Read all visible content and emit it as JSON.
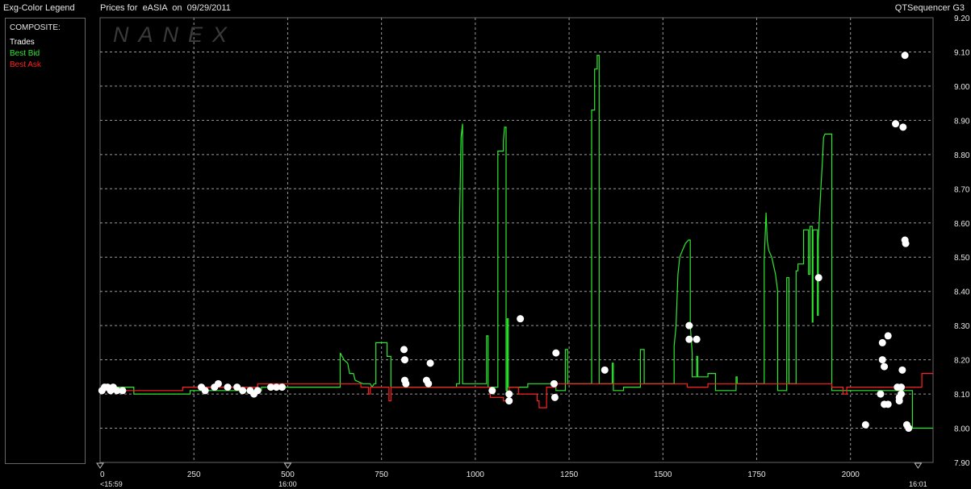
{
  "header": {
    "legend_title": "Exg-Color Legend",
    "chart_title": "Prices for  eASIA  on  09/29/2011",
    "app_name": "QTSequencer G3"
  },
  "legend": {
    "group_label": "COMPOSITE:",
    "items": [
      {
        "label": "Trades",
        "color": "#ffffff"
      },
      {
        "label": "Best Bid",
        "color": "#2ee82e"
      },
      {
        "label": "Best Ask",
        "color": "#ff2020"
      }
    ]
  },
  "watermark": "NANEX",
  "chart_data": {
    "type": "line",
    "title": "Prices for  eASIA  on  09/29/2011",
    "xlim": [
      0,
      2220
    ],
    "ylim": [
      7.9,
      9.2
    ],
    "x_ticks": [
      0,
      250,
      500,
      750,
      1000,
      1250,
      1500,
      1750,
      2000
    ],
    "y_ticks": [
      "9.20",
      "9.10",
      "9.00",
      "8.90",
      "8.80",
      "8.70",
      "8.60",
      "8.50",
      "8.40",
      "8.30",
      "8.20",
      "8.10",
      "8.00",
      "7.90"
    ],
    "time_labels": [
      {
        "x": 0,
        "label": "<15:59"
      },
      {
        "x": 500,
        "label": "16:00"
      },
      {
        "x": 2180,
        "label": "16:01"
      }
    ],
    "grid": true,
    "series": [
      {
        "name": "Best Bid",
        "color": "#2ee82e",
        "points": [
          [
            0,
            8.11
          ],
          [
            20,
            8.12
          ],
          [
            90,
            8.12
          ],
          [
            90,
            8.1
          ],
          [
            240,
            8.1
          ],
          [
            240,
            8.11
          ],
          [
            430,
            8.11
          ],
          [
            430,
            8.12
          ],
          [
            640,
            8.12
          ],
          [
            640,
            8.22
          ],
          [
            650,
            8.2
          ],
          [
            660,
            8.19
          ],
          [
            665,
            8.16
          ],
          [
            675,
            8.16
          ],
          [
            680,
            8.14
          ],
          [
            700,
            8.13
          ],
          [
            720,
            8.13
          ],
          [
            725,
            8.12
          ],
          [
            730,
            8.13
          ],
          [
            735,
            8.13
          ],
          [
            735,
            8.25
          ],
          [
            765,
            8.25
          ],
          [
            765,
            8.21
          ],
          [
            775,
            8.21
          ],
          [
            775,
            8.12
          ],
          [
            950,
            8.12
          ],
          [
            950,
            8.13
          ],
          [
            958,
            8.13
          ],
          [
            958,
            8.6
          ],
          [
            962,
            8.85
          ],
          [
            966,
            8.89
          ],
          [
            966,
            8.13
          ],
          [
            1030,
            8.13
          ],
          [
            1030,
            8.27
          ],
          [
            1034,
            8.27
          ],
          [
            1034,
            8.12
          ],
          [
            1060,
            8.12
          ],
          [
            1060,
            8.81
          ],
          [
            1075,
            8.81
          ],
          [
            1075,
            8.84
          ],
          [
            1078,
            8.88
          ],
          [
            1082,
            8.88
          ],
          [
            1082,
            8.11
          ],
          [
            1085,
            8.11
          ],
          [
            1085,
            8.32
          ],
          [
            1088,
            8.32
          ],
          [
            1088,
            8.12
          ],
          [
            1140,
            8.12
          ],
          [
            1140,
            8.13
          ],
          [
            1215,
            8.13
          ],
          [
            1215,
            8.11
          ],
          [
            1240,
            8.11
          ],
          [
            1240,
            8.23
          ],
          [
            1246,
            8.23
          ],
          [
            1246,
            8.13
          ],
          [
            1310,
            8.13
          ],
          [
            1310,
            8.93
          ],
          [
            1318,
            8.93
          ],
          [
            1318,
            9.05
          ],
          [
            1325,
            9.05
          ],
          [
            1325,
            9.09
          ],
          [
            1330,
            9.09
          ],
          [
            1330,
            8.13
          ],
          [
            1365,
            8.13
          ],
          [
            1365,
            8.19
          ],
          [
            1368,
            8.19
          ],
          [
            1368,
            8.11
          ],
          [
            1395,
            8.11
          ],
          [
            1395,
            8.12
          ],
          [
            1440,
            8.12
          ],
          [
            1440,
            8.23
          ],
          [
            1450,
            8.23
          ],
          [
            1450,
            8.13
          ],
          [
            1530,
            8.13
          ],
          [
            1530,
            8.24
          ],
          [
            1535,
            8.3
          ],
          [
            1540,
            8.45
          ],
          [
            1545,
            8.5
          ],
          [
            1552,
            8.52
          ],
          [
            1560,
            8.54
          ],
          [
            1568,
            8.55
          ],
          [
            1573,
            8.55
          ],
          [
            1573,
            8.3
          ],
          [
            1578,
            8.22
          ],
          [
            1578,
            8.15
          ],
          [
            1590,
            8.15
          ],
          [
            1590,
            8.21
          ],
          [
            1593,
            8.21
          ],
          [
            1593,
            8.15
          ],
          [
            1620,
            8.15
          ],
          [
            1620,
            8.16
          ],
          [
            1640,
            8.16
          ],
          [
            1640,
            8.11
          ],
          [
            1695,
            8.11
          ],
          [
            1695,
            8.15
          ],
          [
            1698,
            8.15
          ],
          [
            1698,
            8.13
          ],
          [
            1770,
            8.13
          ],
          [
            1770,
            8.49
          ],
          [
            1775,
            8.63
          ],
          [
            1778,
            8.55
          ],
          [
            1782,
            8.52
          ],
          [
            1790,
            8.5
          ],
          [
            1800,
            8.45
          ],
          [
            1806,
            8.4
          ],
          [
            1806,
            8.11
          ],
          [
            1830,
            8.11
          ],
          [
            1830,
            8.44
          ],
          [
            1836,
            8.44
          ],
          [
            1836,
            8.13
          ],
          [
            1855,
            8.13
          ],
          [
            1855,
            8.46
          ],
          [
            1860,
            8.46
          ],
          [
            1860,
            8.48
          ],
          [
            1875,
            8.48
          ],
          [
            1875,
            8.58
          ],
          [
            1888,
            8.58
          ],
          [
            1888,
            8.45
          ],
          [
            1892,
            8.45
          ],
          [
            1892,
            8.59
          ],
          [
            1898,
            8.59
          ],
          [
            1898,
            8.31
          ],
          [
            1900,
            8.31
          ],
          [
            1900,
            8.58
          ],
          [
            1912,
            8.58
          ],
          [
            1912,
            8.33
          ],
          [
            1914,
            8.33
          ],
          [
            1914,
            8.55
          ],
          [
            1920,
            8.68
          ],
          [
            1925,
            8.78
          ],
          [
            1928,
            8.85
          ],
          [
            1932,
            8.86
          ],
          [
            1950,
            8.86
          ],
          [
            1950,
            8.11
          ],
          [
            2165,
            8.11
          ],
          [
            2165,
            8.0
          ],
          [
            2220,
            8.0
          ]
        ]
      },
      {
        "name": "Best Ask",
        "color": "#ff2020",
        "points": [
          [
            0,
            8.11
          ],
          [
            220,
            8.11
          ],
          [
            220,
            8.12
          ],
          [
            420,
            8.12
          ],
          [
            420,
            8.13
          ],
          [
            695,
            8.13
          ],
          [
            695,
            8.12
          ],
          [
            715,
            8.12
          ],
          [
            715,
            8.1
          ],
          [
            720,
            8.1
          ],
          [
            720,
            8.12
          ],
          [
            770,
            8.12
          ],
          [
            770,
            8.08
          ],
          [
            775,
            8.08
          ],
          [
            775,
            8.12
          ],
          [
            1040,
            8.12
          ],
          [
            1040,
            8.09
          ],
          [
            1075,
            8.09
          ],
          [
            1075,
            8.08
          ],
          [
            1090,
            8.08
          ],
          [
            1090,
            8.12
          ],
          [
            1115,
            8.12
          ],
          [
            1115,
            8.1
          ],
          [
            1165,
            8.1
          ],
          [
            1165,
            8.08
          ],
          [
            1170,
            8.08
          ],
          [
            1170,
            8.06
          ],
          [
            1190,
            8.06
          ],
          [
            1190,
            8.12
          ],
          [
            1215,
            8.12
          ],
          [
            1215,
            8.13
          ],
          [
            1565,
            8.13
          ],
          [
            1565,
            8.12
          ],
          [
            1620,
            8.12
          ],
          [
            1620,
            8.13
          ],
          [
            1950,
            8.13
          ],
          [
            1950,
            8.12
          ],
          [
            1980,
            8.12
          ],
          [
            1980,
            8.1
          ],
          [
            1990,
            8.1
          ],
          [
            1990,
            8.12
          ],
          [
            2190,
            8.12
          ],
          [
            2190,
            8.16
          ],
          [
            2220,
            8.16
          ]
        ]
      },
      {
        "name": "Trades",
        "color": "#ffffff",
        "points": [
          [
            5,
            8.11
          ],
          [
            12,
            8.12
          ],
          [
            20,
            8.12
          ],
          [
            28,
            8.11
          ],
          [
            35,
            8.12
          ],
          [
            45,
            8.11
          ],
          [
            60,
            8.11
          ],
          [
            270,
            8.12
          ],
          [
            280,
            8.11
          ],
          [
            305,
            8.12
          ],
          [
            315,
            8.13
          ],
          [
            340,
            8.12
          ],
          [
            365,
            8.12
          ],
          [
            380,
            8.11
          ],
          [
            400,
            8.11
          ],
          [
            410,
            8.1
          ],
          [
            420,
            8.11
          ],
          [
            455,
            8.12
          ],
          [
            470,
            8.12
          ],
          [
            485,
            8.12
          ],
          [
            810,
            8.23
          ],
          [
            812,
            8.2
          ],
          [
            812,
            8.14
          ],
          [
            815,
            8.13
          ],
          [
            870,
            8.14
          ],
          [
            875,
            8.13
          ],
          [
            880,
            8.19
          ],
          [
            1045,
            8.11
          ],
          [
            1090,
            8.1
          ],
          [
            1090,
            8.08
          ],
          [
            1120,
            8.32
          ],
          [
            1210,
            8.13
          ],
          [
            1212,
            8.09
          ],
          [
            1215,
            8.22
          ],
          [
            1345,
            8.17
          ],
          [
            1570,
            8.3
          ],
          [
            1570,
            8.26
          ],
          [
            1590,
            8.26
          ],
          [
            1915,
            8.44
          ],
          [
            2040,
            8.01
          ],
          [
            2080,
            8.1
          ],
          [
            2085,
            8.25
          ],
          [
            2085,
            8.2
          ],
          [
            2090,
            8.18
          ],
          [
            2090,
            8.07
          ],
          [
            2100,
            8.27
          ],
          [
            2100,
            8.07
          ],
          [
            2120,
            8.89
          ],
          [
            2125,
            8.12
          ],
          [
            2130,
            8.08
          ],
          [
            2130,
            8.09
          ],
          [
            2135,
            8.1
          ],
          [
            2135,
            8.12
          ],
          [
            2138,
            8.17
          ],
          [
            2140,
            8.88
          ],
          [
            2145,
            9.09
          ],
          [
            2145,
            8.55
          ],
          [
            2147,
            8.54
          ],
          [
            2150,
            8.01
          ],
          [
            2155,
            8.0
          ]
        ]
      }
    ]
  }
}
